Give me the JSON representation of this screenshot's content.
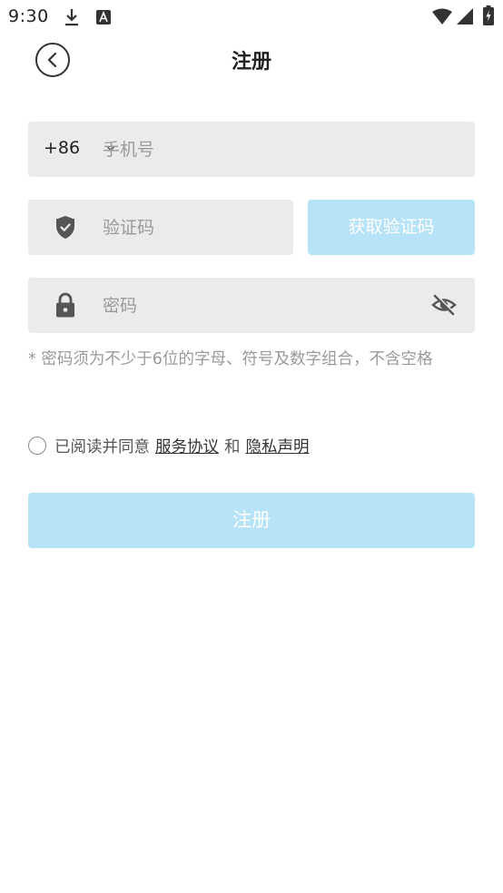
{
  "status_bar": {
    "time": "9:30",
    "icons": [
      "download-icon",
      "a-notification-icon",
      "wifi-icon",
      "signal-icon",
      "battery-charging-icon"
    ]
  },
  "header": {
    "back_icon": "chevron-left-icon",
    "title": "注册"
  },
  "form": {
    "phone": {
      "country_code": "+86",
      "country_chevron_icon": "chevron-down-icon",
      "value": "",
      "placeholder": "手机号"
    },
    "verification_code": {
      "icon": "shield-check-icon",
      "value": "",
      "placeholder": "验证码",
      "get_code_label": "获取验证码"
    },
    "password": {
      "icon": "lock-icon",
      "value": "",
      "placeholder": "密码",
      "visibility_icon": "eye-off-icon"
    },
    "password_hint": "* 密码须为不少于6位的字母、符号及数字组合，不含空格"
  },
  "agreement": {
    "checked": false,
    "prefix": "已阅读并同意",
    "service_link": "服务协议",
    "conjunction": "和",
    "privacy_link": "隐私声明"
  },
  "submit": {
    "label": "注册"
  },
  "colors": {
    "button_disabled_bg": "#b6e3f8",
    "field_bg": "#ebebeb",
    "placeholder": "#9a9a9a",
    "text": "#222222"
  }
}
